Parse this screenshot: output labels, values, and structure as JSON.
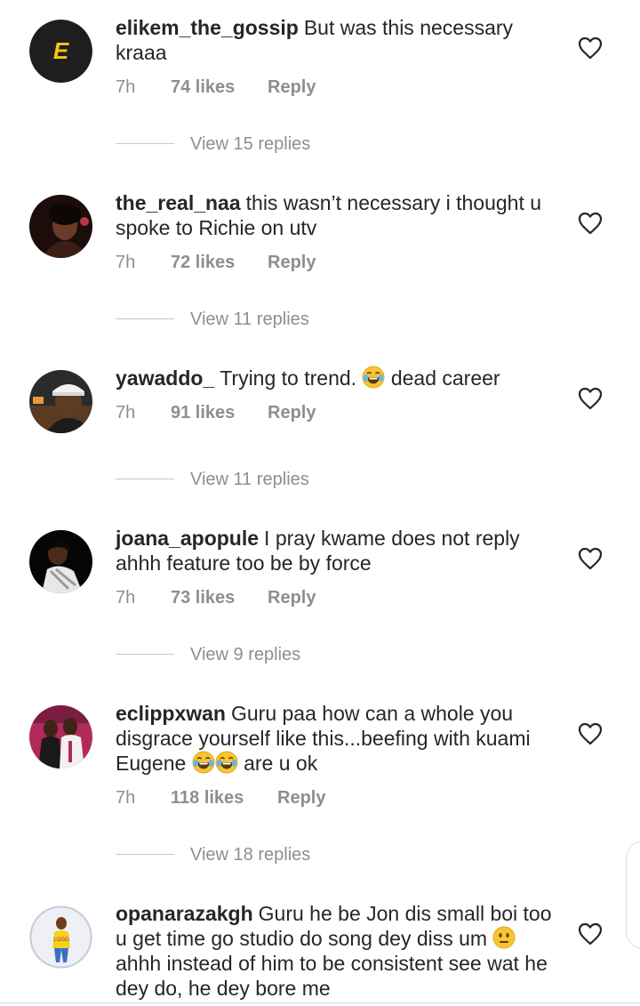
{
  "comments": [
    {
      "username": "elikem_the_gossip",
      "text": "But was this necessary kraaa",
      "time": "7h",
      "likes": "74 likes",
      "reply": "Reply",
      "view_replies": "View 15 replies",
      "avatar": "letter-e-avatar"
    },
    {
      "username": "the_real_naa",
      "text": "this wasn’t necessary i thought u spoke to Richie on utv",
      "time": "7h",
      "likes": "72 likes",
      "reply": "Reply",
      "view_replies": "View 11 replies",
      "avatar": "photo-avatar"
    },
    {
      "username": "yawaddo_",
      "text_before": "Trying to trend.",
      "text_after": "dead career",
      "emoji": "face-with-tears-of-joy",
      "time": "7h",
      "likes": "91 likes",
      "reply": "Reply",
      "view_replies": "View 11 replies",
      "avatar": "photo-avatar"
    },
    {
      "username": "joana_apopule",
      "text": "I pray kwame does not reply ahhh feature too be by force",
      "time": "7h",
      "likes": "73 likes",
      "reply": "Reply",
      "view_replies": "View 9 replies",
      "avatar": "photo-avatar"
    },
    {
      "username": "eclippxwan",
      "text_before": "Guru paa how can a whole you disgrace yourself like this...beefing with kuami Eugene",
      "text_after": "are u ok",
      "emoji": "face-with-tears-of-joy x2",
      "time": "7h",
      "likes": "118 likes",
      "reply": "Reply",
      "view_replies": "View 18 replies",
      "avatar": "photo-avatar"
    },
    {
      "username": "opanarazakgh",
      "text_before": "Guru he be Jon dis small boi too u get time go studio do song dey diss um",
      "text_after": "ahhh instead of him to be consistent see wat he dey do, he dey bore me",
      "emoji": "neutral-face",
      "avatar": "photo-avatar"
    }
  ],
  "icons": {
    "like": "heart-outline-icon"
  },
  "colors": {
    "text": "#262626",
    "meta": "#8e8e8e",
    "divider": "#c7c7c7"
  }
}
